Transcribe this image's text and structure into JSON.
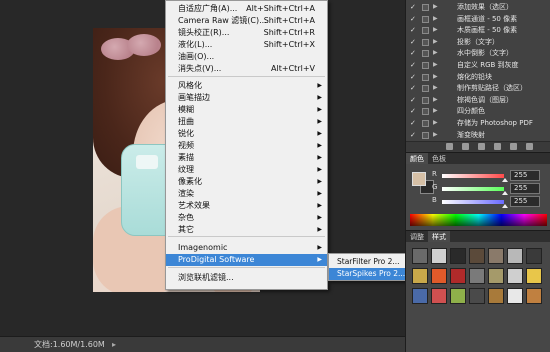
{
  "status": {
    "doc_label": "文档:1.60M/1.60M",
    "arrow": "▸"
  },
  "menu": {
    "items": [
      {
        "label": "自适应广角(A)...",
        "shortcut": "Alt+Shift+Ctrl+A"
      },
      {
        "label": "Camera Raw 滤镜(C)...",
        "shortcut": "Shift+Ctrl+A"
      },
      {
        "label": "镜头校正(R)...",
        "shortcut": "Shift+Ctrl+R"
      },
      {
        "label": "液化(L)...",
        "shortcut": "Shift+Ctrl+X"
      },
      {
        "label": "油画(O)...",
        "shortcut": ""
      },
      {
        "label": "消失点(V)...",
        "shortcut": "Alt+Ctrl+V"
      },
      {
        "label": "风格化",
        "shortcut": ""
      },
      {
        "label": "画笔描边",
        "shortcut": ""
      },
      {
        "label": "模糊",
        "shortcut": ""
      },
      {
        "label": "扭曲",
        "shortcut": ""
      },
      {
        "label": "锐化",
        "shortcut": ""
      },
      {
        "label": "视频",
        "shortcut": ""
      },
      {
        "label": "素描",
        "shortcut": ""
      },
      {
        "label": "纹理",
        "shortcut": ""
      },
      {
        "label": "像素化",
        "shortcut": ""
      },
      {
        "label": "渲染",
        "shortcut": ""
      },
      {
        "label": "艺术效果",
        "shortcut": ""
      },
      {
        "label": "杂色",
        "shortcut": ""
      },
      {
        "label": "其它",
        "shortcut": ""
      },
      {
        "label": "Imagenomic",
        "shortcut": ""
      },
      {
        "label": "ProDigital Software",
        "shortcut": ""
      },
      {
        "label": "浏览联机滤镜...",
        "shortcut": ""
      }
    ]
  },
  "submenu": {
    "items": [
      "StarFilter Pro 2...",
      "StarSpikes Pro 2..."
    ]
  },
  "actions": {
    "rows": [
      "添加效果（选区）",
      "画框通道 - 50 像素",
      "木质画框 - 50 像素",
      "投影（文字）",
      "水中倒影（文字）",
      "自定义 RGB 到灰度",
      "熔化的铅块",
      "制作剪贴路径（选区）",
      "棕褐色调（图层）",
      "四分颜色",
      "存储为 Photoshop PDF",
      "渐变映射"
    ]
  },
  "color_panel": {
    "tabs": [
      "颜色",
      "色板"
    ],
    "channels": [
      {
        "label": "R",
        "value": "255",
        "color": "#ff4a4a"
      },
      {
        "label": "G",
        "value": "255",
        "color": "#5aff5a"
      },
      {
        "label": "B",
        "value": "255",
        "color": "#6a6aff"
      }
    ]
  },
  "styles_panel": {
    "tabs": [
      "调整",
      "样式"
    ]
  },
  "colors": {
    "menu_highlight": "#3c86d6",
    "panel_bg": "#474747"
  }
}
